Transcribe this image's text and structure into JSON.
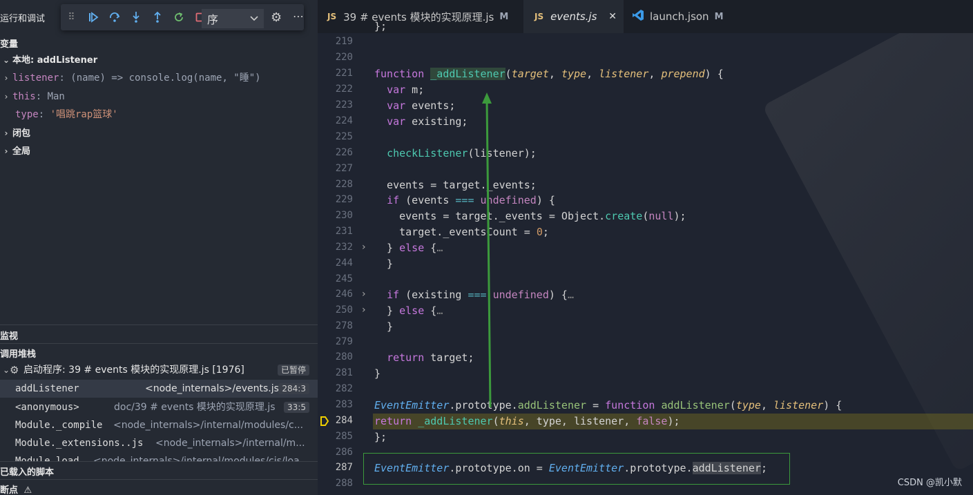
{
  "sidebar": {
    "title": "运行和调试",
    "config_select": "序",
    "variables_header": "变量",
    "local_scope": "本地: addListener",
    "variables": [
      {
        "name": "listener",
        "sep": ": ",
        "value": "(name) => console.log(name, \"睡\")"
      },
      {
        "name": "this",
        "sep": ": ",
        "value": "Man"
      },
      {
        "name": "type",
        "sep": ": ",
        "value": "'唱跳rap篮球'"
      }
    ],
    "closure": "闭包",
    "global": "全局",
    "watch_header": "监视",
    "callstack_header": "调用堆栈",
    "session_label": "启动程序: 39 # events 模块的实现原理.js [1976]",
    "session_status": "已暂停",
    "frames": [
      {
        "fn": "addListener",
        "src": "<node_internals>/events.js",
        "pos": "284:3"
      },
      {
        "fn": "<anonymous>",
        "src": "doc/39 # events 模块的实现原理.js",
        "pos": "33:5"
      },
      {
        "fn": "Module._compile",
        "src": "<node_internals>/internal/modules/c...",
        "pos": ""
      },
      {
        "fn": "Module._extensions..js",
        "src": "<node_internals>/internal/m...",
        "pos": ""
      },
      {
        "fn": "Module.load",
        "src": "<node_internals>/internal/modules/cjs/loa...",
        "pos": ""
      }
    ],
    "loaded_scripts": "已载入的脚本",
    "breakpoints": "断点"
  },
  "tabs": [
    {
      "type": "JS",
      "label": "39 # events 模块的实现原理.js",
      "mod": "M"
    },
    {
      "type": "JS",
      "label": "events.js",
      "close": "✕"
    },
    {
      "type": "JSON",
      "label": "launch.json",
      "mod": "M"
    }
  ],
  "line_numbers": [
    "219",
    "220",
    "221",
    "222",
    "223",
    "224",
    "225",
    "226",
    "227",
    "228",
    "229",
    "230",
    "231",
    "232",
    "244",
    "245",
    "246",
    "250",
    "278",
    "279",
    "280",
    "281",
    "282",
    "283",
    "284",
    "285",
    "286",
    "287",
    "288"
  ],
  "watermark": "CSDN @凯小默",
  "colors": {
    "accent": "#3c9a3c",
    "breakpoint": "#f0d000"
  }
}
